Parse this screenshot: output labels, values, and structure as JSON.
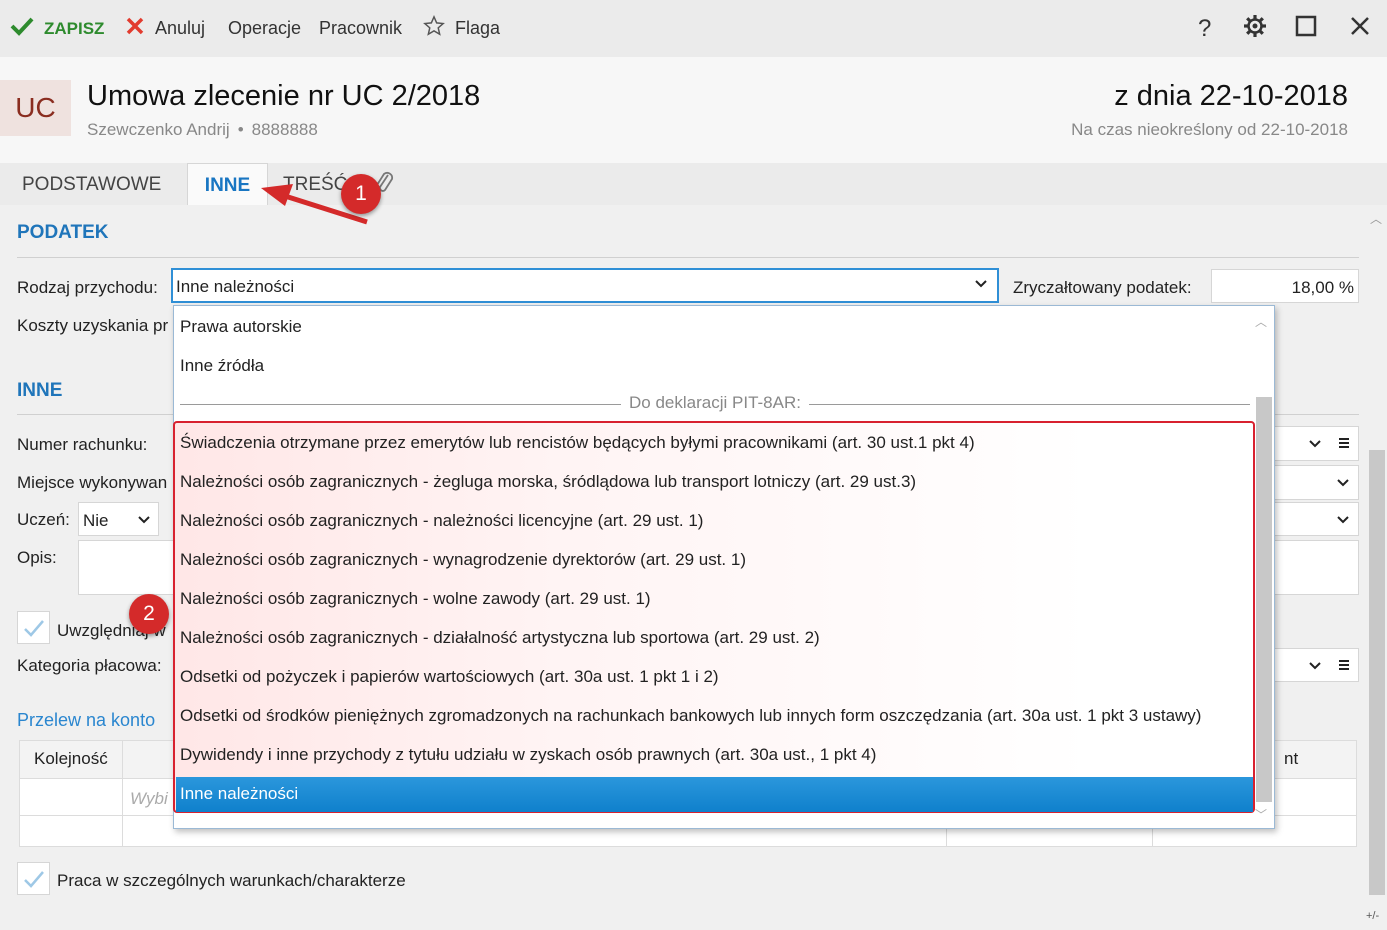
{
  "toolbar": {
    "save_label": "ZAPISZ",
    "cancel_label": "Anuluj",
    "operations_label": "Operacje",
    "employee_label": "Pracownik",
    "flag_label": "Flaga",
    "help_icon": "?",
    "save_icon": "check-icon",
    "cancel_icon": "x-icon"
  },
  "header": {
    "badge": "UC",
    "title": "Umowa zlecenie nr UC 2/2018",
    "person": "Szewczenko Andrij",
    "separator": "•",
    "id_number": "8888888",
    "date_title": "z dnia 22-10-2018",
    "period": "Na czas nieokreślony od 22-10-2018"
  },
  "tabs": {
    "basic": "PODSTAWOWE",
    "other": "INNE",
    "content": "TREŚĆ",
    "active": "INNE"
  },
  "podatek": {
    "title": "PODATEK",
    "income_type_label": "Rodzaj przychodu:",
    "income_type_value": "Inne należności",
    "flat_tax_label": "Zryczałtowany podatek:",
    "flat_tax_value": "18,00 %",
    "costs_label": "Koszty uzyskania pr"
  },
  "inne": {
    "title": "INNE",
    "account_label": "Numer rachunku:",
    "place_label": "Miejsce wykonywan",
    "student_label": "Uczeń:",
    "student_value": "Nie",
    "description_label": "Opis:",
    "include_label": "Uwzględniaj w",
    "category_label": "Kategoria płacowa:",
    "transfer_link": "Przelew na konto",
    "table_headers": [
      "Kolejność",
      "nt"
    ],
    "table_placeholder": "Wybi",
    "special_conditions_label": "Praca w szczególnych warunkach/charakterze"
  },
  "dropdown": {
    "options_top": [
      "Prawa autorskie",
      "Inne źródła"
    ],
    "group_header": "Do deklaracji PIT-8AR:",
    "options_group": [
      "Świadczenia otrzymane przez emerytów lub rencistów będących byłymi pracownikami (art. 30 ust.1 pkt 4)",
      "Należności osób zagranicznych - żegluga morska, śródlądowa lub transport lotniczy (art. 29 ust.3)",
      "Należności osób zagranicznych - należności licencyjne (art. 29 ust. 1)",
      "Należności osób zagranicznych - wynagrodzenie dyrektorów (art. 29 ust. 1)",
      "Należności osób zagranicznych - wolne zawody (art. 29 ust. 1)",
      "Należności osób zagranicznych - działalność artystyczna lub sportowa (art. 29 ust. 2)",
      "Odsetki od pożyczek i papierów wartościowych (art. 30a ust. 1 pkt 1 i 2)",
      "Odsetki od środków pieniężnych zgromadzonych na rachunkach bankowych lub innych form oszczędzania (art. 30a ust. 1 pkt 3 ustawy)",
      "Dywidendy  i inne przychody z tytułu udziału w zyskach osób prawnych (art. 30a ust., 1 pkt 4)",
      "Inne należności"
    ],
    "selected": "Inne należności"
  },
  "annotations": {
    "marker1": "1",
    "marker2": "2"
  },
  "footer": {
    "corner": "+/-"
  },
  "colors": {
    "accent": "#1f75ba",
    "selection": "#1a87d4",
    "marker": "#d42a2a",
    "save_green": "#2e8b2e"
  }
}
